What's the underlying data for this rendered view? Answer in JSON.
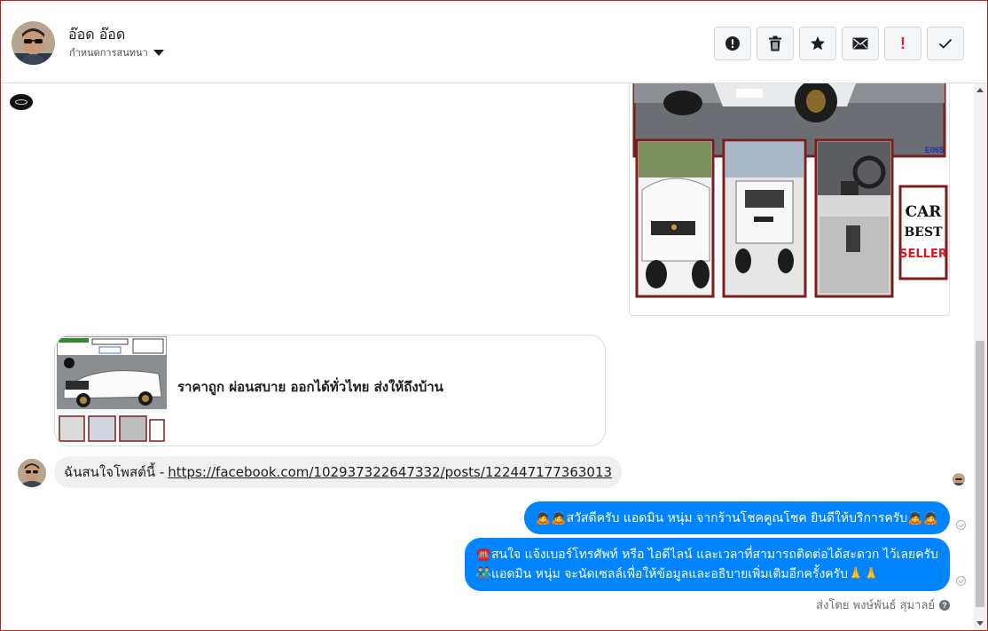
{
  "header": {
    "contact_name": "อ๊อด อ๊อด",
    "assign_label": "กำหนดการสนทนา",
    "toolbar": [
      {
        "name": "spam-button",
        "icon": "alert-circle-icon"
      },
      {
        "name": "delete-button",
        "icon": "trash-icon"
      },
      {
        "name": "star-button",
        "icon": "star-icon"
      },
      {
        "name": "mark-unread-button",
        "icon": "envelope-icon"
      },
      {
        "name": "follow-up-button",
        "icon": "exclamation-icon",
        "glyph": "!"
      },
      {
        "name": "mark-done-button",
        "icon": "checkmark-icon"
      }
    ]
  },
  "conversation": {
    "shared_post": {
      "text": "ราคาถูก ผ่อนสบาย ออกได้ทั่วไทย ส่งให้ถึงบ้าน"
    },
    "incoming": {
      "prefix": "ฉันสนใจโพสต์นี้ -",
      "link": "https://facebook.com/102937322647332/posts/122447177363013"
    },
    "outgoing": [
      {
        "text": "🙇🙇สวัสดีครับ แอดมิน หนุ่ม จากร้านโชคคูณโชค ยินดีให้บริการครับ🙇🙇"
      },
      {
        "line1": "☎️สนใจ แจ้งเบอร์โทรศัพท์ หรือ ไอดีไลน์ และเวลาที่สามารถติดต่อได้สะดวก ไว้เลยครับ",
        "line2": "👬แอดมิน หนุ่ม จะนัดเซลล์เพื่อให้ข้อมูลและอธิบายเพิ่มเติมอีกครั้งครับ🙏🙏"
      }
    ],
    "sent_by": "ส่งโดย พงษ์พันธ์ สุมาลย์",
    "help_glyph": "?"
  },
  "image": {
    "badge_text": "E065",
    "logo_lines": [
      "CAR",
      "BEST",
      "SELLER"
    ]
  },
  "colors": {
    "outgoing_bubble": "#0084ff",
    "incoming_bubble": "#f1f0f0",
    "frame_border": "#c81e1e"
  }
}
